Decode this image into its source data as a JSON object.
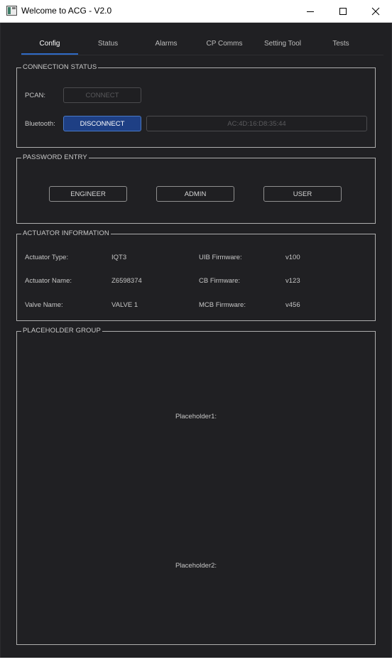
{
  "window": {
    "title": "Welcome to ACG - V2.0"
  },
  "tabs": [
    {
      "label": "Config",
      "active": true
    },
    {
      "label": "Status",
      "active": false
    },
    {
      "label": "Alarms",
      "active": false
    },
    {
      "label": "CP Comms",
      "active": false
    },
    {
      "label": "Setting Tool",
      "active": false
    },
    {
      "label": "Tests",
      "active": false
    }
  ],
  "connection_status": {
    "title": "CONNECTION STATUS",
    "pcan_label": "PCAN:",
    "pcan_button": "CONNECT",
    "bluetooth_label": "Bluetooth:",
    "bluetooth_button": "DISCONNECT",
    "bluetooth_address": "AC:4D:16:D8:35:44"
  },
  "password_entry": {
    "title": "PASSWORD ENTRY",
    "engineer_button": "ENGINEER",
    "admin_button": "ADMIN",
    "user_button": "USER"
  },
  "actuator_information": {
    "title": "ACTUATOR INFORMATION",
    "rows": [
      {
        "label": "Actuator Type:",
        "value": "IQT3",
        "fw_label": "UIB Firmware:",
        "fw_value": "v100"
      },
      {
        "label": "Actuator Name:",
        "value": "Z6598374",
        "fw_label": "CB Firmware:",
        "fw_value": "v123"
      },
      {
        "label": "Valve Name:",
        "value": "VALVE 1",
        "fw_label": "MCB Firmware:",
        "fw_value": "v456"
      }
    ]
  },
  "placeholder_group": {
    "title": "PLACEHOLDER GROUP",
    "placeholder1": "Placeholder1:",
    "placeholder2": "Placeholder2:"
  },
  "colors": {
    "background": "#202023",
    "accent": "#2f6bc6",
    "primary_button": "#1e3f84",
    "group_border": "#aeaeae",
    "text": "#c6c6c6"
  }
}
